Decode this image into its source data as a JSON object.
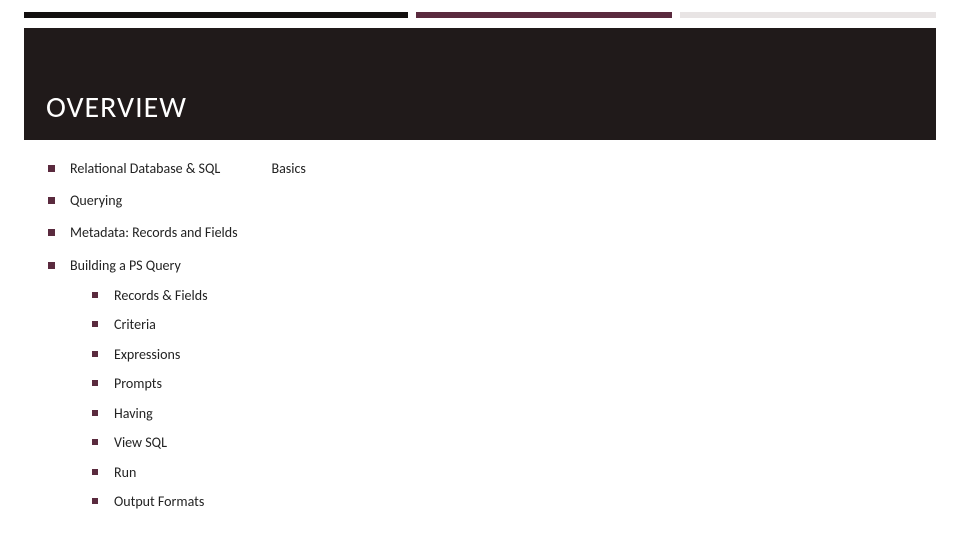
{
  "title": "OVERVIEW",
  "bullets": {
    "b0": "Relational Database & SQL",
    "b0_extra": "Basics",
    "b1": "Querying",
    "b2": "Metadata: Records and Fields",
    "b3": "Building a PS Query"
  },
  "sub": {
    "s0": "Records & Fields",
    "s1": "Criteria",
    "s2": "Expressions",
    "s3": "Prompts",
    "s4": "Having",
    "s5": "View SQL",
    "s6": "Run",
    "s7": "Output Formats"
  }
}
